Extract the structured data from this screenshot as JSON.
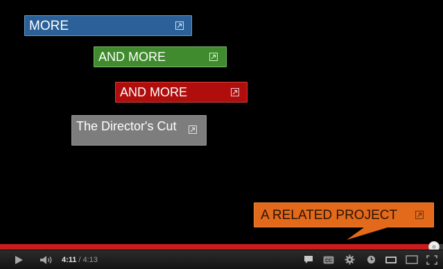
{
  "annotations": [
    {
      "label": "MORE",
      "color": "#2b6099"
    },
    {
      "label": "AND MORE",
      "color": "#3f8b2d"
    },
    {
      "label": "AND MORE",
      "color": "#b00d0d"
    },
    {
      "label": "The Director's Cut",
      "color": "#7d7d7d"
    },
    {
      "label": "A RELATED PROJECT",
      "color": "#e3691b"
    }
  ],
  "player": {
    "current_time": "4:11",
    "separator": "/",
    "duration": "4:13",
    "progress_fraction": 0.98,
    "progress_color": "#c91c1c",
    "icons": {
      "play": "play-icon",
      "volume": "volume-icon",
      "annotations": "annotations-icon",
      "captions": "captions-icon",
      "settings": "gear-icon",
      "watch_later": "watch-later-icon",
      "small_player": "small-player-icon",
      "large_player": "large-player-icon",
      "fullscreen": "fullscreen-icon"
    }
  }
}
